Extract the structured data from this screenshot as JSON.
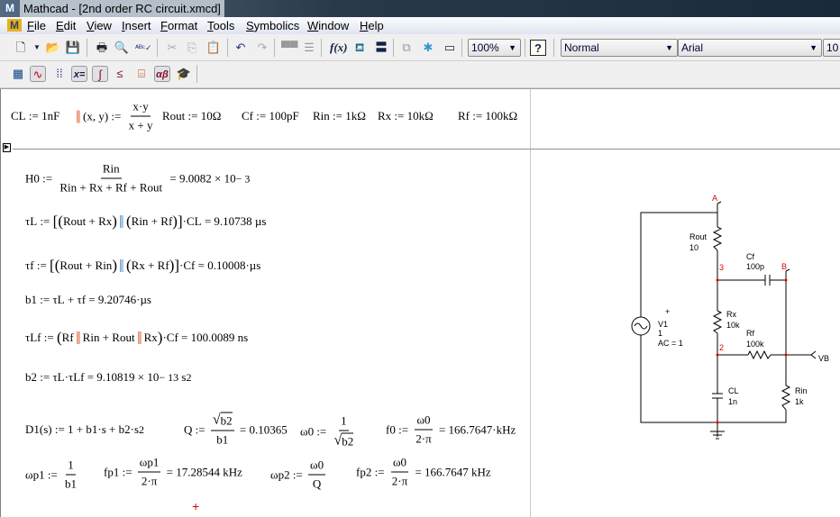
{
  "window": {
    "title": "Mathcad - [2nd order RC circuit.xmcd]"
  },
  "menu": [
    "File",
    "Edit",
    "View",
    "Insert",
    "Format",
    "Tools",
    "Symbolics",
    "Window",
    "Help"
  ],
  "toolbar": {
    "zoom": "100%",
    "style": "Normal",
    "font": "Arial",
    "size": "10"
  },
  "colors": {
    "parallel_highlight": "#a8c8e8",
    "cursor": "#e00000",
    "node_label": "#e00000"
  },
  "equations": {
    "CL": [
      "C",
      {
        "b": "",
        "s": "L"
      },
      " := 1nF"
    ],
    "par": [
      {
        "par": "o"
      },
      "(x, y) := ",
      {
        "n": [
          "x·y"
        ],
        "d": [
          "x + y"
        ]
      }
    ],
    "Rout": [
      "R",
      {
        "s": "out"
      },
      " := 10Ω"
    ],
    "Cf": [
      "C",
      {
        "s": "f"
      },
      " := 100pF"
    ],
    "Rin": [
      "R",
      {
        "s": "in"
      },
      " := 1kΩ"
    ],
    "Rx": [
      "R",
      {
        "s": "x"
      },
      " := 10kΩ"
    ],
    "Rf": [
      "R",
      {
        "s": "f"
      },
      " := 100kΩ"
    ],
    "H0": [
      "H",
      {
        "s": "0"
      },
      " := ",
      {
        "n": [
          "R",
          {
            "s": "in"
          }
        ],
        "d": [
          "R",
          {
            "s": "in"
          },
          " + R",
          {
            "s": "x"
          },
          " + R",
          {
            "s": "f"
          },
          " + R",
          {
            "s": "out"
          }
        ]
      },
      " = 9.0082 × 10",
      {
        "p": "− 3"
      }
    ],
    "tauL": [
      "τ",
      {
        "s": "L"
      },
      " := ",
      {
        "g": "["
      },
      {
        "g": "("
      },
      "R",
      {
        "s": "out"
      },
      " + R",
      {
        "s": "x"
      },
      {
        "g": ")"
      },
      {
        "par": ""
      },
      {
        "g": "("
      },
      "R",
      {
        "s": "in"
      },
      " + R",
      {
        "s": "f"
      },
      {
        "g": ")"
      },
      {
        "g": "]"
      },
      "·C",
      {
        "s": "L"
      },
      " = 9.10738 µs"
    ],
    "tauf": [
      "τ",
      {
        "s": "f"
      },
      " := ",
      {
        "g": "["
      },
      {
        "g": "("
      },
      "R",
      {
        "s": "out"
      },
      " + R",
      {
        "s": "in"
      },
      {
        "g": ")"
      },
      {
        "par": ""
      },
      {
        "g": "("
      },
      "R",
      {
        "s": "x"
      },
      " + R",
      {
        "s": "f"
      },
      {
        "g": ")"
      },
      {
        "g": "]"
      },
      "·C",
      {
        "s": "f"
      },
      " = 0.10008·µs"
    ],
    "b1": [
      "b",
      {
        "s": "1"
      },
      " := τ",
      {
        "s": "L"
      },
      " + τ",
      {
        "s": "f"
      },
      " = 9.20746·µs"
    ],
    "tauLf": [
      "τ",
      {
        "s": "Lf"
      },
      " := ",
      {
        "g": "("
      },
      "R",
      {
        "s": "f"
      },
      {
        "par": "o"
      },
      "R",
      {
        "s": "in"
      },
      " + R",
      {
        "s": "out"
      },
      {
        "par": "o"
      },
      "R",
      {
        "s": "x"
      },
      {
        "g": ")"
      },
      "·C",
      {
        "s": "f"
      },
      " = 100.0089 ns"
    ],
    "b2": [
      "b",
      {
        "s": "2"
      },
      " := τ",
      {
        "s": "L"
      },
      "·τ",
      {
        "s": "Lf"
      },
      " = 9.10819 × 10",
      {
        "p": "− 13"
      },
      " s",
      {
        "p": "2"
      }
    ],
    "D1": [
      "D",
      {
        "s": "1"
      },
      "(s) := 1 + b",
      {
        "s": "1"
      },
      "·s + b",
      {
        "s": "2"
      },
      "·s",
      {
        "p": "2"
      }
    ],
    "Q": [
      "Q := ",
      {
        "n": [
          {
            "r": [
              "b",
              {
                "s": "2"
              }
            ]
          }
        ],
        "d": [
          "b",
          {
            "s": "1"
          }
        ]
      },
      " = 0.10365"
    ],
    "w0": [
      "ω",
      {
        "s": "0"
      },
      " := ",
      {
        "n": [
          "1"
        ],
        "d": [
          {
            "r": [
              "b",
              {
                "s": "2"
              }
            ]
          }
        ]
      }
    ],
    "f0": [
      "f",
      {
        "s": "0"
      },
      " := ",
      {
        "n": [
          "ω",
          {
            "s": "0"
          }
        ],
        "d": [
          "2·π"
        ]
      },
      " = 166.7647·kHz"
    ],
    "wp1": [
      "ω",
      {
        "s": "p1"
      },
      " := ",
      {
        "n": [
          "1"
        ],
        "d": [
          "b",
          {
            "s": "1"
          }
        ]
      }
    ],
    "fp1": [
      "f",
      {
        "s": "p1"
      },
      " := ",
      {
        "n": [
          "ω",
          {
            "s": "p1"
          }
        ],
        "d": [
          "2·π"
        ]
      },
      " = 17.28544 kHz"
    ],
    "wp2": [
      "ω",
      {
        "s": "p2"
      },
      " := ",
      {
        "n": [
          "ω",
          {
            "s": "0"
          }
        ],
        "d": [
          "Q"
        ]
      }
    ],
    "fp2": [
      "f",
      {
        "s": "p2"
      },
      " := ",
      {
        "n": [
          "ω",
          {
            "s": "0"
          }
        ],
        "d": [
          "2·π"
        ]
      },
      " = 166.7647 kHz"
    ]
  },
  "circuit": {
    "nodes": {
      "a": "A",
      "b": "B",
      "n3": "3",
      "n2": "2"
    },
    "V1": {
      "name": "V1",
      "value": "1",
      "ac": "AC = 1"
    },
    "Rout": {
      "name": "Rout",
      "value": "10"
    },
    "Cf": {
      "name": "Cf",
      "value": "100p"
    },
    "Rx": {
      "name": "Rx",
      "value": "10k"
    },
    "Rf": {
      "name": "Rf",
      "value": "100k"
    },
    "CL": {
      "name": "CL",
      "value": "1n"
    },
    "Rin": {
      "name": "Rin",
      "value": "1k"
    },
    "probe": "VB"
  }
}
